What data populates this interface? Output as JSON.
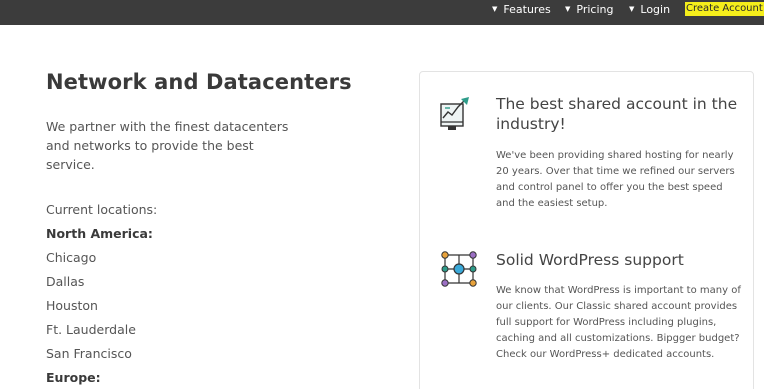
{
  "nav": {
    "items": [
      {
        "label": "Features"
      },
      {
        "label": "Pricing"
      },
      {
        "label": "Login"
      }
    ],
    "cta_label": "Create Account",
    "caret_icon": "caret-down-icon",
    "colors": {
      "bar": "#3c3c3c",
      "cta_bg": "#f5ee1b"
    }
  },
  "main": {
    "title": "Network and Datacenters",
    "intro": "We partner with the finest datacenters and networks to provide the best service.",
    "locations_label": "Current locations:",
    "regions": [
      {
        "name": "North America:",
        "cities": [
          "Chicago",
          "Dallas",
          "Houston",
          "Ft. Lauderdale",
          "San Francisco"
        ]
      },
      {
        "name": "Europe:",
        "cities": []
      }
    ]
  },
  "card": {
    "features": [
      {
        "icon": "chart-growth-icon",
        "title": "The best shared account in the industry!",
        "text": "We've been providing shared hosting for nearly 20 years. Over that time we refined our servers and control panel to offer you the best speed and the easiest setup."
      },
      {
        "icon": "network-nodes-icon",
        "title": "Solid WordPress support",
        "text": "We know that WordPress is important to many of our clients. Our Classic shared account provides full support for WordPress including plugins, caching and all customizations. Bipgger budget? Check our WordPress+ dedicated accounts."
      }
    ]
  }
}
